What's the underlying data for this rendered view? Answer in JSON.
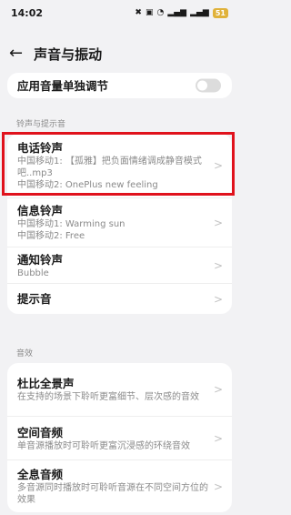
{
  "status_bar": {
    "time": "14:02",
    "battery": "51"
  },
  "header": {
    "title": "声音与振动"
  },
  "top_setting": {
    "label": "应用音量单独调节"
  },
  "section_ringtones": {
    "label": "铃声与提示音",
    "items": [
      {
        "title": "电话铃声",
        "lines": [
          "中国移动1: 【孤雅】把负面情绪调成静音模式吧..mp3",
          "中国移动2: OnePlus new feeling"
        ]
      },
      {
        "title": "信息铃声",
        "lines": [
          "中国移动1: Warming sun",
          "中国移动2: Free"
        ]
      },
      {
        "title": "通知铃声",
        "lines": [
          "Bubble"
        ]
      },
      {
        "title": "提示音",
        "lines": []
      }
    ]
  },
  "section_effects": {
    "label": "音效",
    "items": [
      {
        "title": "杜比全景声",
        "lines": [
          "在支持的场景下聆听更富细节、层次感的音效"
        ]
      },
      {
        "title": "空间音频",
        "lines": [
          "单音源播放时可聆听更富沉浸感的环绕音效"
        ]
      },
      {
        "title": "全息音频",
        "lines": [
          "多音源同时播放时可聆听音源在不同空间方位的效果"
        ]
      }
    ]
  }
}
